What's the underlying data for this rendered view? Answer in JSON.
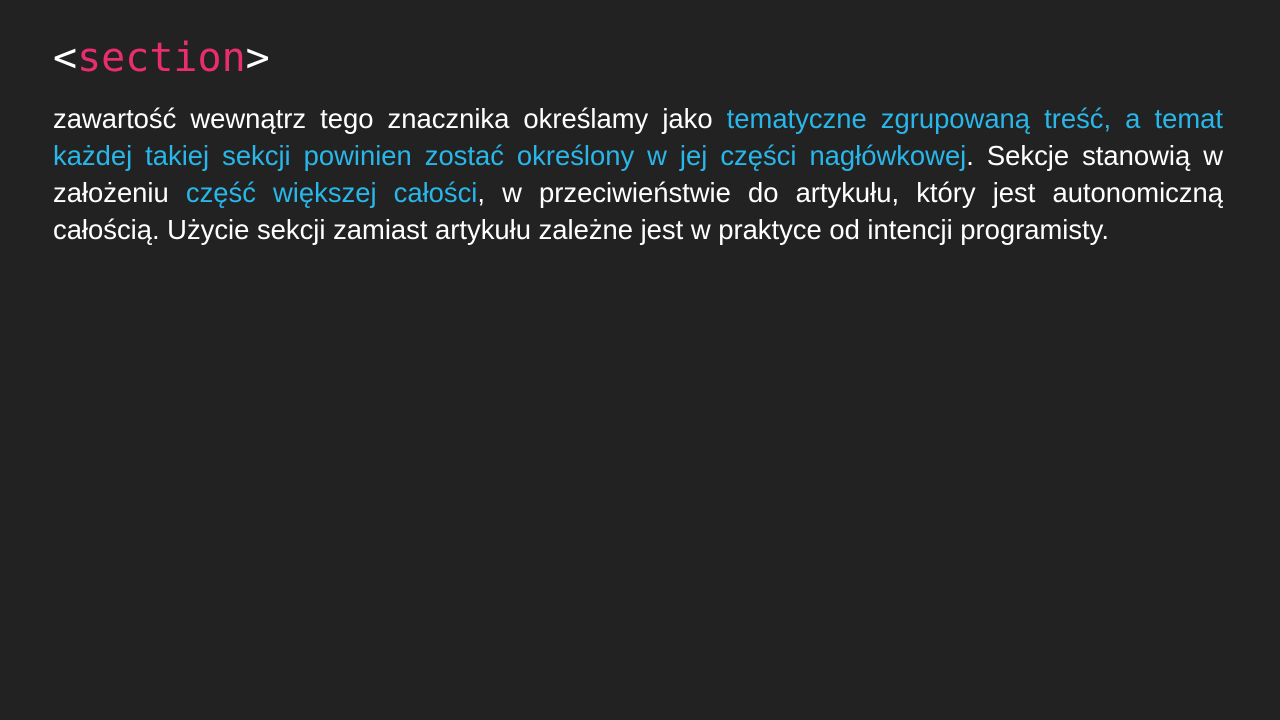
{
  "title": {
    "open_bracket": "<",
    "tag_name": "section",
    "close_bracket": ">"
  },
  "paragraph": {
    "part1": "zawartość wewnątrz tego znacznika określamy jako ",
    "highlight1": "tematyczne zgrupowaną treść, a temat każdej takiej sekcji powinien zostać określony w jej części nagłówkowej",
    "part2": ". Sekcje stanowią w założeniu ",
    "highlight2": "część większej całości",
    "part3": ", w przeciwieństwie do artykułu, który jest autonomiczną całością. Użycie sekcji zamiast artykułu zależne jest w praktyce od intencji programisty."
  },
  "colors": {
    "background": "#222222",
    "text": "#ffffff",
    "tag_name": "#ea2d6f",
    "highlight": "#29b6e8"
  }
}
